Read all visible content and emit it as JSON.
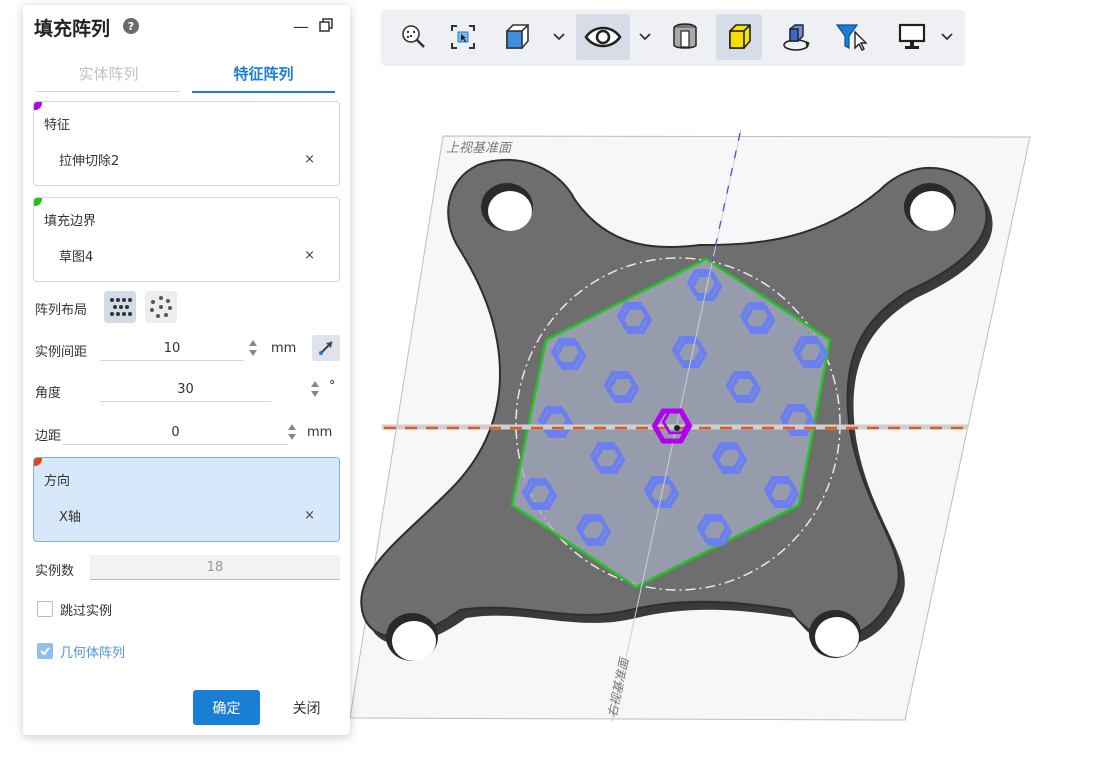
{
  "panel": {
    "title": "填充阵列",
    "help_glyph": "?",
    "minimize_glyph": "—",
    "restore_glyph": "🗗",
    "tabs": [
      {
        "label": "实体阵列",
        "active": false
      },
      {
        "label": "特征阵列",
        "active": true
      }
    ],
    "feature_box": {
      "label": "特征",
      "value": "拉伸切除2",
      "clear": "×",
      "color": "#b000f0"
    },
    "boundary_box": {
      "label": "填充边界",
      "value": "草图4",
      "clear": "×",
      "color": "#22c322"
    },
    "layout_label": "阵列布局",
    "spacing": {
      "label": "实例间距",
      "value": "10",
      "unit": "mm"
    },
    "angle": {
      "label": "角度",
      "value": "30",
      "unit": "°"
    },
    "margin": {
      "label": "边距",
      "value": "0",
      "unit": "mm"
    },
    "direction_box": {
      "label": "方向",
      "value": "X轴",
      "clear": "×",
      "color": "#d94a1a"
    },
    "instance_count": {
      "label": "实例数",
      "value": "18"
    },
    "skip_instances": {
      "label": "跳过实例",
      "checked": false
    },
    "geometry_pattern": {
      "label": "几何体阵列",
      "checked": true
    },
    "ok_label": "确定",
    "close_label": "关闭"
  },
  "viewport": {
    "top_plane_label": "上视基准面",
    "right_plane_label": "右视基准面"
  },
  "toolbar": {
    "icons": [
      "zoom-to-fit-icon",
      "zoom-to-area-icon",
      "view-orientation-icon",
      "hide-show-icon",
      "section-view-icon",
      "display-style-icon",
      "rotate-view-icon",
      "selection-filter-icon",
      "display-settings-icon"
    ]
  },
  "colors": {
    "accent": "#1a7fd4",
    "hex_feature": "#6b7ff0",
    "boundary": "#22c322",
    "axis": "#e05a1e"
  }
}
